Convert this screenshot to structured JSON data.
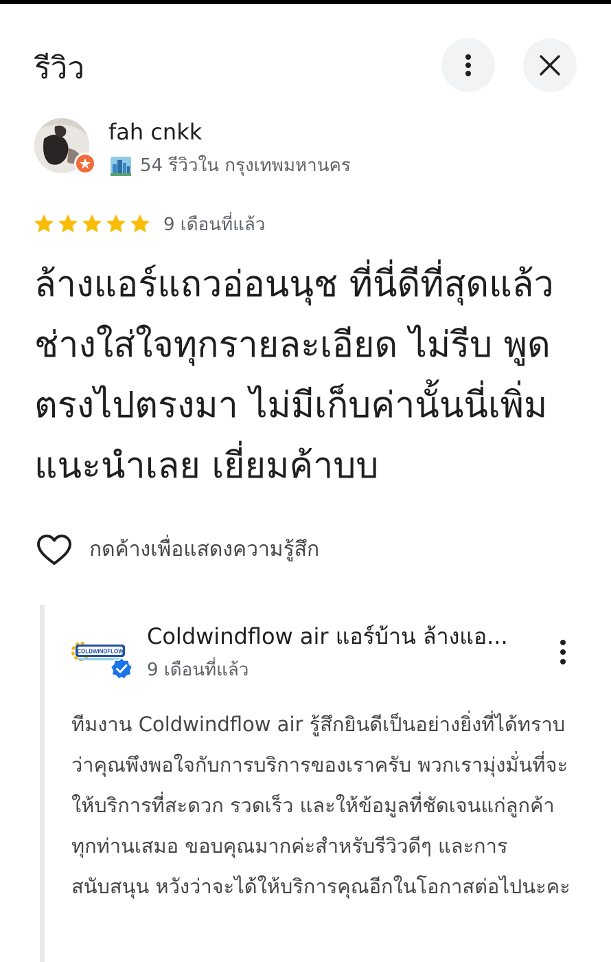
{
  "header": {
    "title": "รีวิว",
    "more_icon": "more-vert-icon",
    "close_icon": "close-icon"
  },
  "review": {
    "reviewer_name": "fah cnkk",
    "reviewer_meta": "54 รีวิวใน กรุงเทพมหานคร",
    "badge_icon": "local-guide-star-icon",
    "city_icon": "city-skyline-icon",
    "rating": 5,
    "rating_max": 5,
    "time": "9 เดือนที่แล้ว",
    "text": "ล้างแอร์แถวอ่อนนุช ที่นี่ดีที่สุดแล้ว ช่างใส่ใจทุกรายละเอียด ไม่รีบ พูดตรงไปตรงมา ไม่มีเก็บค่านั้นนี่เพิ่ม แนะนำเลย เยี่ยมค้าบบ",
    "react_label": "กดค้างเพื่อแสดงความรู้สึก",
    "react_icon": "heart-outline-icon"
  },
  "owner_reply": {
    "owner_name": "Coldwindflow air แอร์บ้าน ล้างแอ...",
    "logo_text": "COLDWINDFLOW",
    "verified_icon": "verified-badge-icon",
    "time": "9 เดือนที่แล้ว",
    "text": "ทีมงาน Coldwindflow air รู้สึกยินดีเป็นอย่างยิ่งที่ได้ทราบว่าคุณพึงพอใจกับการบริการของเราครับ พวกเรามุ่งมั่นที่จะให้บริการที่สะดวก รวดเร็ว และให้ข้อมูลที่ชัดเจนแก่ลูกค้าทุกท่านเสมอ ขอบคุณมากค่ะสำหรับรีวิวดีๆ และการสนับสนุน หวังว่าจะได้ให้บริการคุณอีกในโอกาสต่อไปนะคะ"
  },
  "colors": {
    "star": "#fbbc04",
    "badge": "#f26c38",
    "verified": "#1a73e8",
    "secondary_text": "#5f6368"
  }
}
